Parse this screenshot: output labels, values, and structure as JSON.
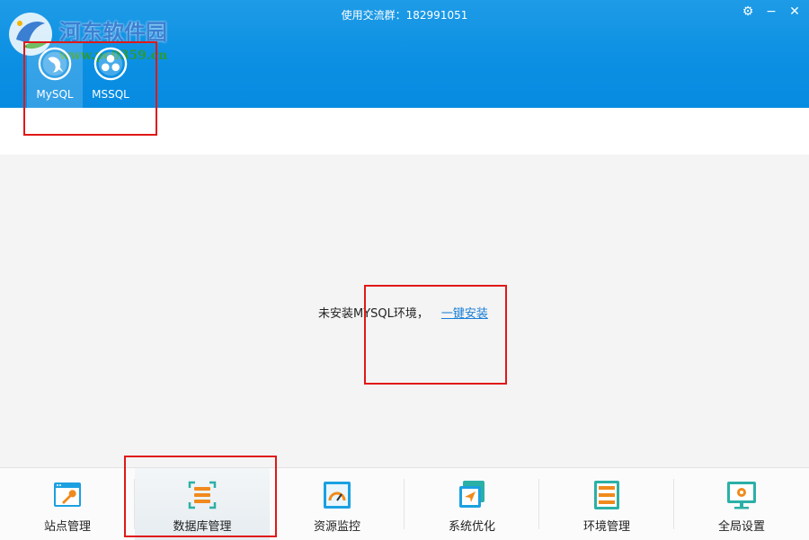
{
  "header": {
    "group_text": "使用交流群：182991051",
    "controls": [
      {
        "name": "settings-icon",
        "glyph": "⚙"
      },
      {
        "name": "minimize-icon",
        "glyph": "−"
      },
      {
        "name": "close-icon",
        "glyph": "✕"
      }
    ],
    "colors": {
      "header_blue": "#0a8fe3",
      "highlight_red": "#e01818",
      "link_blue": "#1a7fd6"
    }
  },
  "watermark": {
    "title": "河东软件园",
    "url": "www.pc0359.cn"
  },
  "db_tabs": [
    {
      "label": "MySQL",
      "icon": "mysql-dolphin-icon",
      "active": true
    },
    {
      "label": "MSSQL",
      "icon": "mssql-icon",
      "active": false
    }
  ],
  "main": {
    "notice_text": "未安装MYSQL环境，",
    "install_link": "一键安装"
  },
  "bottom_nav": [
    {
      "label": "站点管理",
      "icon": "site-wrench-icon",
      "active": false
    },
    {
      "label": "数据库管理",
      "icon": "database-icon",
      "active": true
    },
    {
      "label": "资源监控",
      "icon": "gauge-icon",
      "active": false
    },
    {
      "label": "系统优化",
      "icon": "optimize-arrow-icon",
      "active": false
    },
    {
      "label": "环境管理",
      "icon": "server-rack-icon",
      "active": false
    },
    {
      "label": "全局设置",
      "icon": "monitor-gear-icon",
      "active": false
    }
  ]
}
